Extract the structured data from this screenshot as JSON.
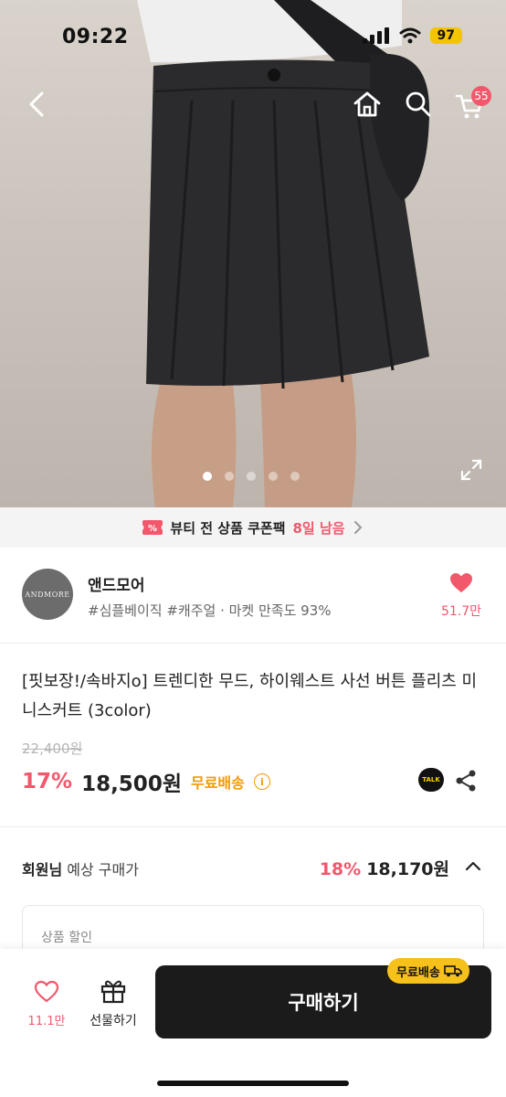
{
  "status_bar": {
    "time": "09:22",
    "battery": "97"
  },
  "nav": {
    "cart_count": "55"
  },
  "gallery": {
    "total_images": 5,
    "active_index": 0
  },
  "coupon_banner": {
    "text": "뷰티 전 상품 쿠폰팩",
    "highlight": "8일 남음"
  },
  "seller": {
    "logo_text": "ANDMORE",
    "name": "앤드모어",
    "tags": "#심플베이직 #캐주얼 · 마켓 만족도 93%",
    "likes": "51.7만"
  },
  "product": {
    "title": "[핏보장!/속바지o] 트렌디한 무드, 하이웨스트 사선 버튼 플리츠 미니스커트 (3color)",
    "original_price": "22,400원",
    "discount_rate": "17%",
    "price": "18,500원",
    "shipping": "무료배송",
    "talk_label": "TALK"
  },
  "member_price": {
    "label_bold": "회원님",
    "label_rest": " 예상 구매가",
    "discount_rate": "18%",
    "price": "18,170원"
  },
  "discount_box": {
    "label": "상품 할인"
  },
  "bottom_bar": {
    "wish_count": "11.1만",
    "gift_label": "선물하기",
    "buy_label": "구매하기",
    "ship_badge": "무료배송"
  },
  "colors": {
    "accent": "#f2576c",
    "shipping": "#f29a00",
    "button": "#1b1b1b",
    "badge": "#f7c11b"
  }
}
